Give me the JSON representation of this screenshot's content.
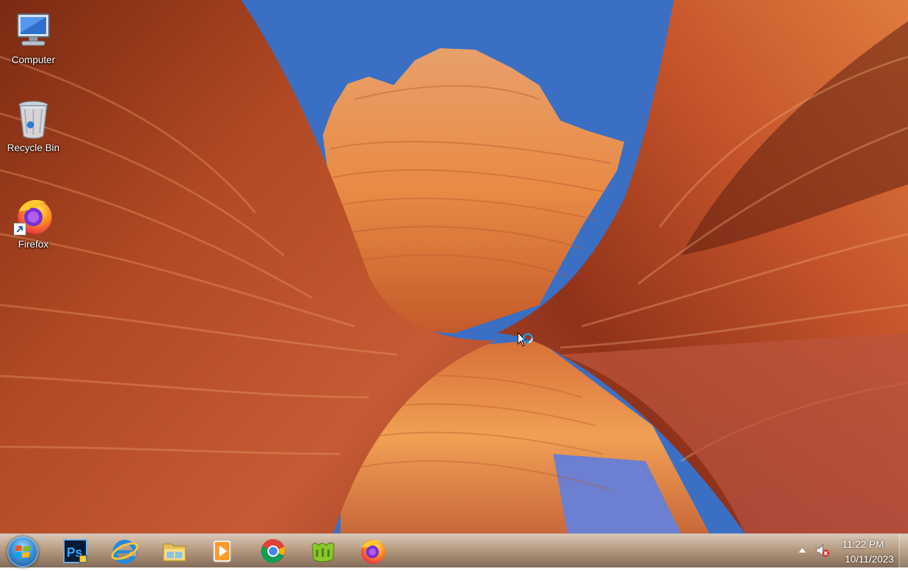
{
  "desktop": {
    "icons": [
      {
        "name": "computer",
        "label": "Computer"
      },
      {
        "name": "recycle-bin",
        "label": "Recycle Bin"
      },
      {
        "name": "firefox",
        "label": "Firefox"
      }
    ]
  },
  "taskbar": {
    "start_icon": "windows-logo-icon",
    "pinned": [
      {
        "name": "photoshop",
        "icon": "photoshop-icon",
        "text": "Ps"
      },
      {
        "name": "internet-explorer",
        "icon": "internet-explorer-icon"
      },
      {
        "name": "file-explorer",
        "icon": "folder-icon"
      },
      {
        "name": "media-player",
        "icon": "media-player-icon"
      },
      {
        "name": "chrome",
        "icon": "chrome-icon"
      },
      {
        "name": "game",
        "icon": "game-icon"
      },
      {
        "name": "firefox",
        "icon": "firefox-icon"
      }
    ],
    "tray": {
      "show_hidden_icon": "chevron-up-icon",
      "volume_icon": "volume-muted-icon",
      "time": "11:22 PM",
      "date": "10/11/2023"
    }
  },
  "colors": {
    "taskbar": "#a88a6d",
    "rock": "#c8522a",
    "sky": "#3a6fc4"
  }
}
